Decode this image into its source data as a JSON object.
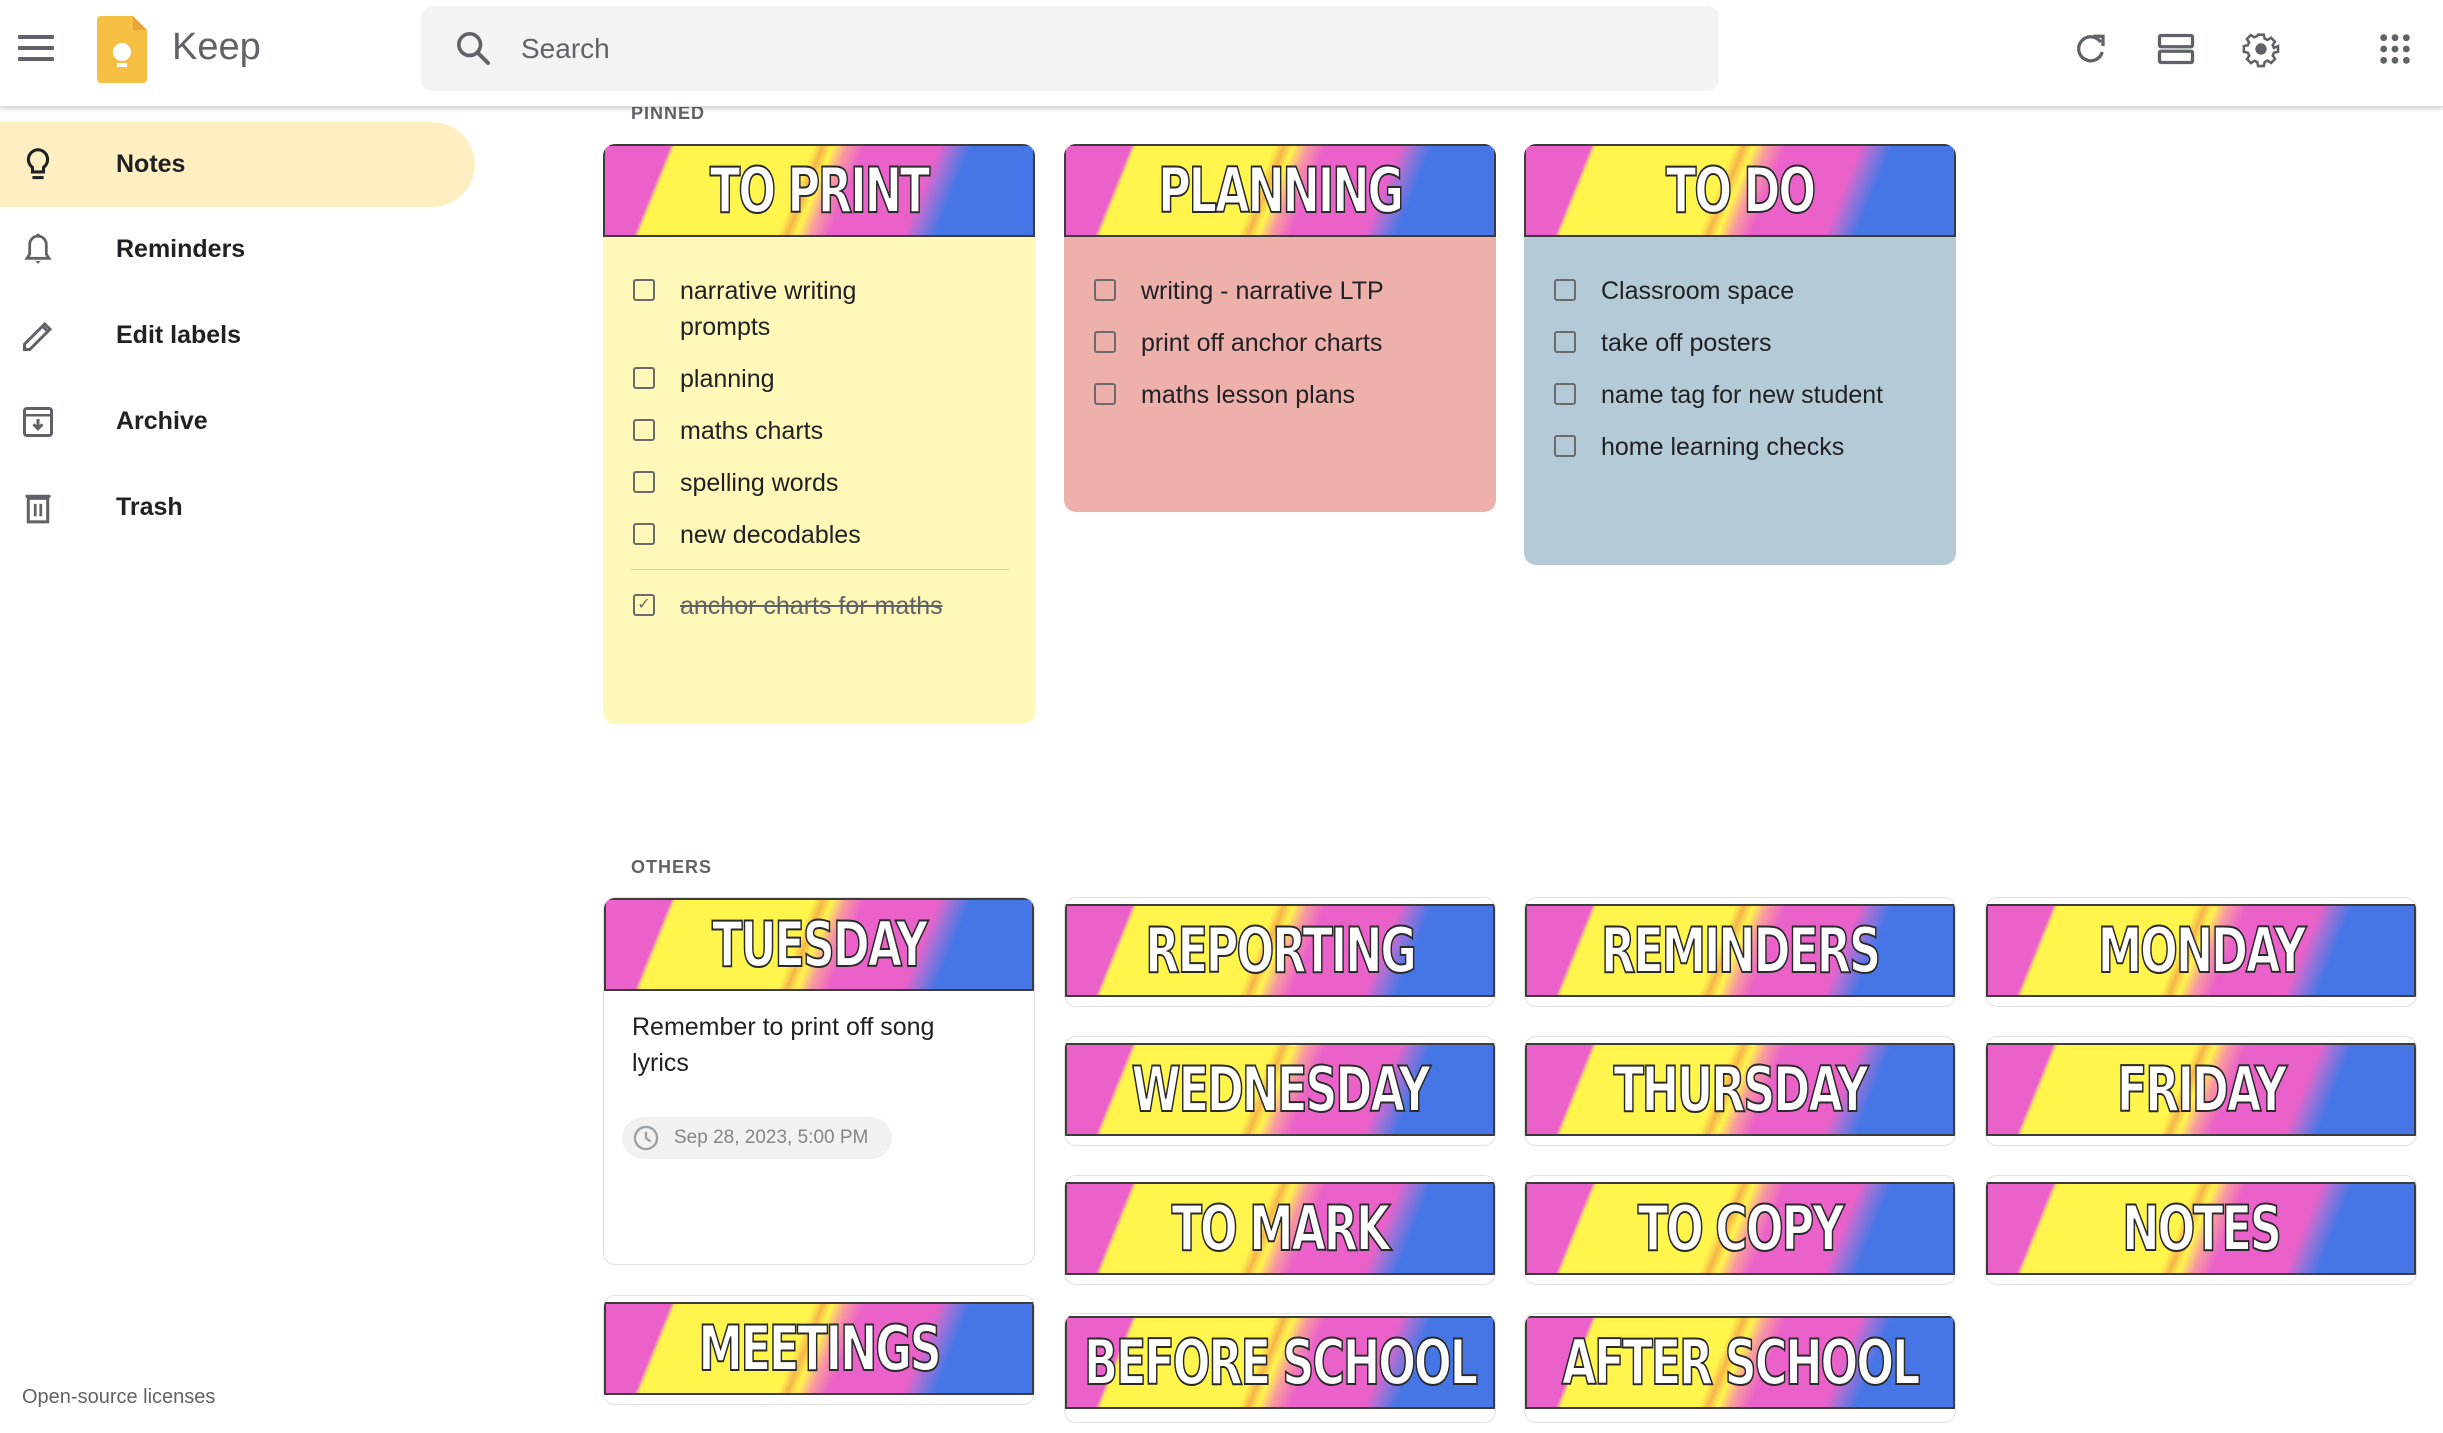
{
  "app": {
    "title": "Keep",
    "brand_color": "#F4B400"
  },
  "search": {
    "placeholder": "Search",
    "value": ""
  },
  "header_icons": [
    "refresh-icon",
    "list-view-icon",
    "settings-icon",
    "apps-grid-icon"
  ],
  "sidebar": {
    "items": [
      {
        "label": "Notes",
        "icon": "lightbulb-icon",
        "active": true
      },
      {
        "label": "Reminders",
        "icon": "bell-icon",
        "active": false
      },
      {
        "label": "Edit labels",
        "icon": "pencil-icon",
        "active": false
      },
      {
        "label": "Archive",
        "icon": "archive-icon",
        "active": false
      },
      {
        "label": "Trash",
        "icon": "trash-icon",
        "active": false
      }
    ],
    "active_color": "#FEEFC3",
    "footer_link": "Open-source licenses"
  },
  "pinned": {
    "label": "PINNED",
    "notes": [
      {
        "banner": "TO PRINT",
        "color": "#FFF8B8",
        "items": [
          {
            "text": "narrative writing prompts",
            "checked": false
          },
          {
            "text": "planning",
            "checked": false
          },
          {
            "text": "maths charts",
            "checked": false
          },
          {
            "text": "spelling words",
            "checked": false
          },
          {
            "text": "new decodables",
            "checked": false
          }
        ],
        "completed": [
          {
            "text": "anchor charts for maths",
            "checked": true
          }
        ]
      },
      {
        "banner": "PLANNING",
        "color": "#EEB0AA",
        "items": [
          {
            "text": "writing - narrative LTP",
            "checked": false
          },
          {
            "text": "print off anchor charts",
            "checked": false
          },
          {
            "text": "maths lesson plans",
            "checked": false
          }
        ]
      },
      {
        "banner": "TO DO",
        "color": "#B4CAD7",
        "items": [
          {
            "text": "Classroom space",
            "checked": false
          },
          {
            "text": "take off posters",
            "checked": false
          },
          {
            "text": "name tag for new student",
            "checked": false
          },
          {
            "text": "home learning checks",
            "checked": false
          }
        ]
      }
    ]
  },
  "others": {
    "label": "OTHERS",
    "notes": [
      {
        "banner": "TUESDAY",
        "text": "Remember to print off song lyrics",
        "reminder": "Sep 28, 2023, 5:00 PM"
      },
      {
        "banner": "REPORTING"
      },
      {
        "banner": "REMINDERS"
      },
      {
        "banner": "MONDAY"
      },
      {
        "banner": "WEDNESDAY"
      },
      {
        "banner": "THURSDAY"
      },
      {
        "banner": "FRIDAY"
      },
      {
        "banner": "TO MARK"
      },
      {
        "banner": "TO COPY"
      },
      {
        "banner": "NOTES"
      },
      {
        "banner": "MEETINGS"
      },
      {
        "banner": "BEFORE SCHOOL"
      },
      {
        "banner": "AFTER SCHOOL"
      }
    ]
  }
}
